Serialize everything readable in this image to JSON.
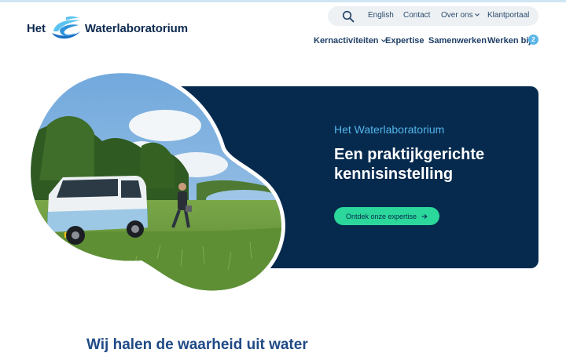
{
  "logo": {
    "word_left": "Het",
    "word_right": "Waterlaboratorium",
    "mark_icon": "water-drop-swirl-icon",
    "colors": {
      "mark_light": "#5bc3f0",
      "mark_dark": "#1a6fc4"
    }
  },
  "utility_nav": {
    "search_icon": "search-icon",
    "items": [
      {
        "label": "English"
      },
      {
        "label": "Contact"
      },
      {
        "label": "Over ons",
        "dropdown": true
      },
      {
        "label": "Klantportaal"
      }
    ]
  },
  "main_nav": {
    "items": [
      {
        "label": "Kernactiviteiten",
        "dropdown": true
      },
      {
        "label": "Expertise"
      },
      {
        "label": "Samenwerken"
      },
      {
        "label": "Werken bij",
        "badge": "2"
      }
    ]
  },
  "hero": {
    "eyebrow": "Het Waterlaboratorium",
    "title": "Een praktijkgerichte kennisinstelling",
    "cta_label": "Ontdek onze expertise",
    "cta_icon": "arrow-right-icon",
    "photo": "field-van-person-lake-photo",
    "colors": {
      "panel": "#062a4e",
      "eyebrow": "#54b4ea",
      "cta": "#2bd79a"
    }
  },
  "section": {
    "heading": "Wij halen de waarheid uit water"
  }
}
